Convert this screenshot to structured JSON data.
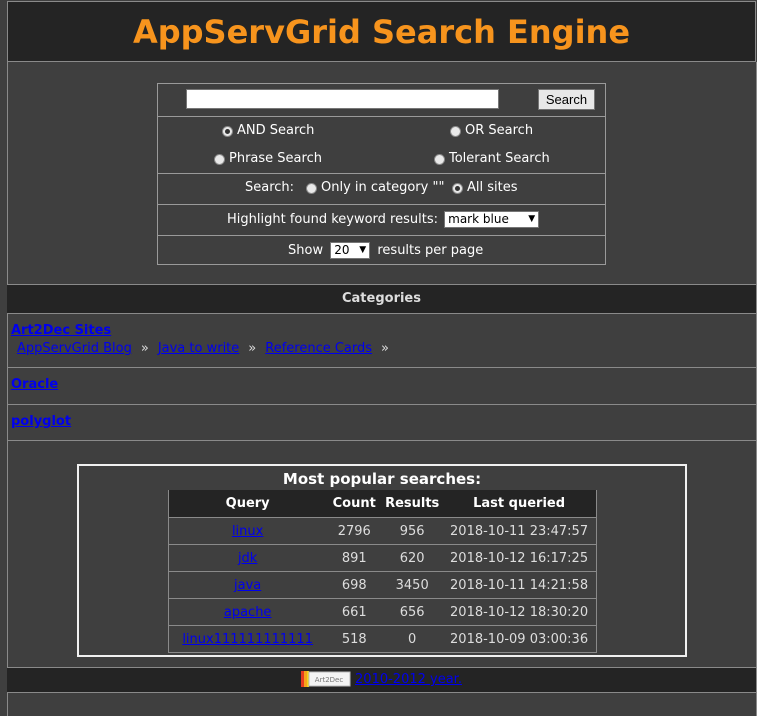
{
  "header": {
    "title": "AppServGrid Search Engine"
  },
  "search": {
    "query_value": "",
    "query_placeholder": "",
    "button_label": "Search",
    "modes": [
      {
        "label": "AND Search",
        "selected": true
      },
      {
        "label": "OR Search",
        "selected": false
      },
      {
        "label": "Phrase Search",
        "selected": false
      },
      {
        "label": "Tolerant Search",
        "selected": false
      }
    ],
    "scope_label": "Search:",
    "scope_options": [
      {
        "label": "Only in category \"\"",
        "selected": false
      },
      {
        "label": "All sites",
        "selected": true
      }
    ],
    "highlight_label": "Highlight found keyword results:",
    "highlight_value": "mark blue",
    "show_label": "Show",
    "per_page_value": "20",
    "per_page_suffix": "results per page"
  },
  "categories": {
    "heading": "Categories",
    "items": [
      {
        "title": "Art2Dec Sites",
        "subs": [
          "AppServGrid Blog",
          "Java to write",
          "Reference Cards"
        ]
      },
      {
        "title": "Oracle",
        "subs": []
      },
      {
        "title": "polyglot",
        "subs": []
      }
    ],
    "separator": "»"
  },
  "popular": {
    "title": "Most popular searches:",
    "columns": [
      "Query",
      "Count",
      "Results",
      "Last queried"
    ],
    "rows": [
      [
        "linux",
        "2796",
        "956",
        "2018-10-11 23:47:57"
      ],
      [
        "jdk",
        "891",
        "620",
        "2018-10-12 16:17:25"
      ],
      [
        "java",
        "698",
        "3450",
        "2018-10-11 14:21:58"
      ],
      [
        "apache",
        "661",
        "656",
        "2018-10-12 18:30:20"
      ],
      [
        "linux111111111111",
        "518",
        "0",
        "2018-10-09 03:00:36"
      ]
    ]
  },
  "footer": {
    "logo_text": "Art2Dec",
    "link_text": "2010-2012 year."
  },
  "colors": {
    "title_orange": "#f7941d",
    "link_blue": "#0000ee",
    "bar_dark": "#242424",
    "page_bg": "#3f3f3f"
  }
}
